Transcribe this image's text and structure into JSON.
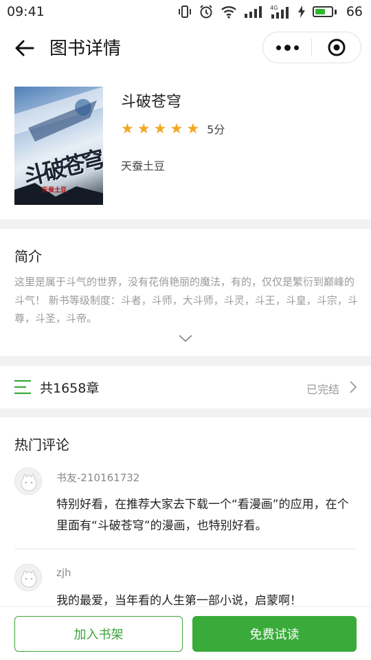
{
  "status_bar": {
    "time": "09:41",
    "battery_percent": "66",
    "battery_level": 0.66,
    "network_label": "4G",
    "icons": [
      "vibrate-icon",
      "alarm-icon",
      "wifi-icon",
      "signal-icon",
      "signal-4g-icon",
      "charging-icon",
      "battery-icon"
    ]
  },
  "nav": {
    "title": "图书详情",
    "back_icon": "arrow-left-icon",
    "more_icon": "more-dots-icon",
    "close_icon": "target-circle-icon"
  },
  "book": {
    "title": "斗破苍穹",
    "rating_stars": 5,
    "rating_label": "5分",
    "author": "天蚕土豆",
    "cover_title": "斗破苍穹",
    "cover_author": "天蚕土豆"
  },
  "intro": {
    "heading": "简介",
    "text": "这里是属于斗气的世界，没有花俏艳丽的魔法，有的，仅仅是繁衍到巅峰的斗气！ 新书等级制度：斗者，斗师，大斗师，斗灵，斗王，斗皇，斗宗，斗尊，斗圣，斗帝。",
    "expand_icon": "chevron-down-icon"
  },
  "chapters": {
    "count_label": "共1658章",
    "status": "已完结",
    "list_icon": "list-icon",
    "arrow_icon": "chevron-right-icon"
  },
  "comments": {
    "heading": "热门评论",
    "items": [
      {
        "user": "书友-210161732",
        "text": "特别好看，在推荐大家去下载一个“看漫画”的应用，在个里面有“斗破苍穹”的漫画，也特别好看。"
      },
      {
        "user": "zjh",
        "text": "我的最爱，当年看的人生第一部小说，启蒙啊！"
      }
    ]
  },
  "bottom": {
    "add_shelf_label": "加入书架",
    "free_read_label": "免费试读"
  },
  "colors": {
    "accent_green": "#3aaa3a",
    "star": "#f5a623",
    "muted_text": "#9a9a9a"
  }
}
